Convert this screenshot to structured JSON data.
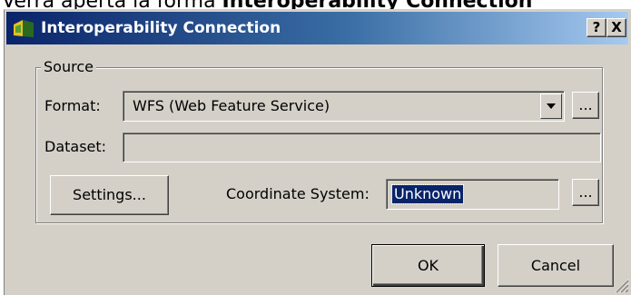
{
  "background_caption": {
    "prefix": "Verrà aperta la forma ",
    "bold": "Interoperability Connection"
  },
  "window": {
    "title": "Interoperability Connection",
    "help_label": "?",
    "close_label": "X"
  },
  "source_group": {
    "label": "Source",
    "format": {
      "label": "Format:",
      "value": "WFS (Web Feature Service)",
      "browse_label": "..."
    },
    "dataset": {
      "label": "Dataset:",
      "value": ""
    },
    "settings_button": "Settings...",
    "coordinate_system": {
      "label": "Coordinate System:",
      "value": "Unknown",
      "browse_label": "..."
    }
  },
  "buttons": {
    "ok": "OK",
    "cancel": "Cancel"
  },
  "colors": {
    "dialog_face": "#d4d0c8",
    "title_start": "#0a246a",
    "title_end": "#a6caf0",
    "selection": "#0a246a"
  }
}
